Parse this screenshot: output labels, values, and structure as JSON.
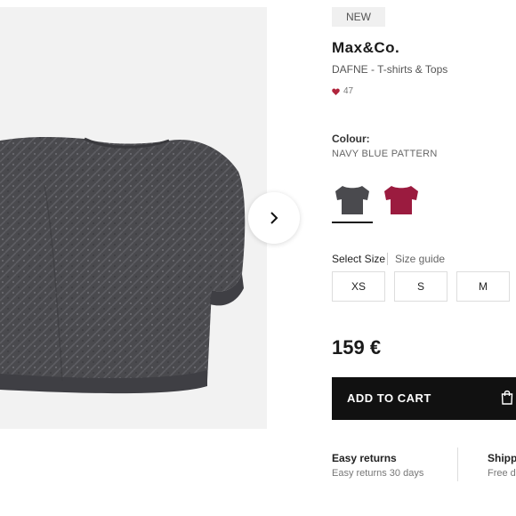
{
  "badge": "NEW",
  "brand": "Max&Co.",
  "subtitle": "DAFNE - T-shirts & Tops",
  "likes": "47",
  "colour": {
    "label": "Colour:",
    "value": "NAVY BLUE PATTERN",
    "swatches": [
      {
        "name": "navy-blue-pattern",
        "color": "#4a4a4e",
        "selected": true
      },
      {
        "name": "raspberry",
        "color": "#9b1b3f",
        "selected": false
      }
    ]
  },
  "size": {
    "label": "Select Size",
    "guide": "Size guide",
    "options": [
      "XS",
      "S",
      "M"
    ]
  },
  "price": "159 €",
  "cart": {
    "label": "ADD TO CART"
  },
  "info": [
    {
      "title": "Easy returns",
      "sub": "Easy returns 30 days"
    },
    {
      "title": "Shipp",
      "sub": "Free d"
    }
  ],
  "colors": {
    "knit": "#4a4a4e",
    "gallery_bg": "#f2f2f2",
    "cart_bg": "#111111",
    "heart": "#b0243c"
  },
  "icons": [
    "chevron-right-icon",
    "heart-icon",
    "shopping-bag-icon"
  ]
}
